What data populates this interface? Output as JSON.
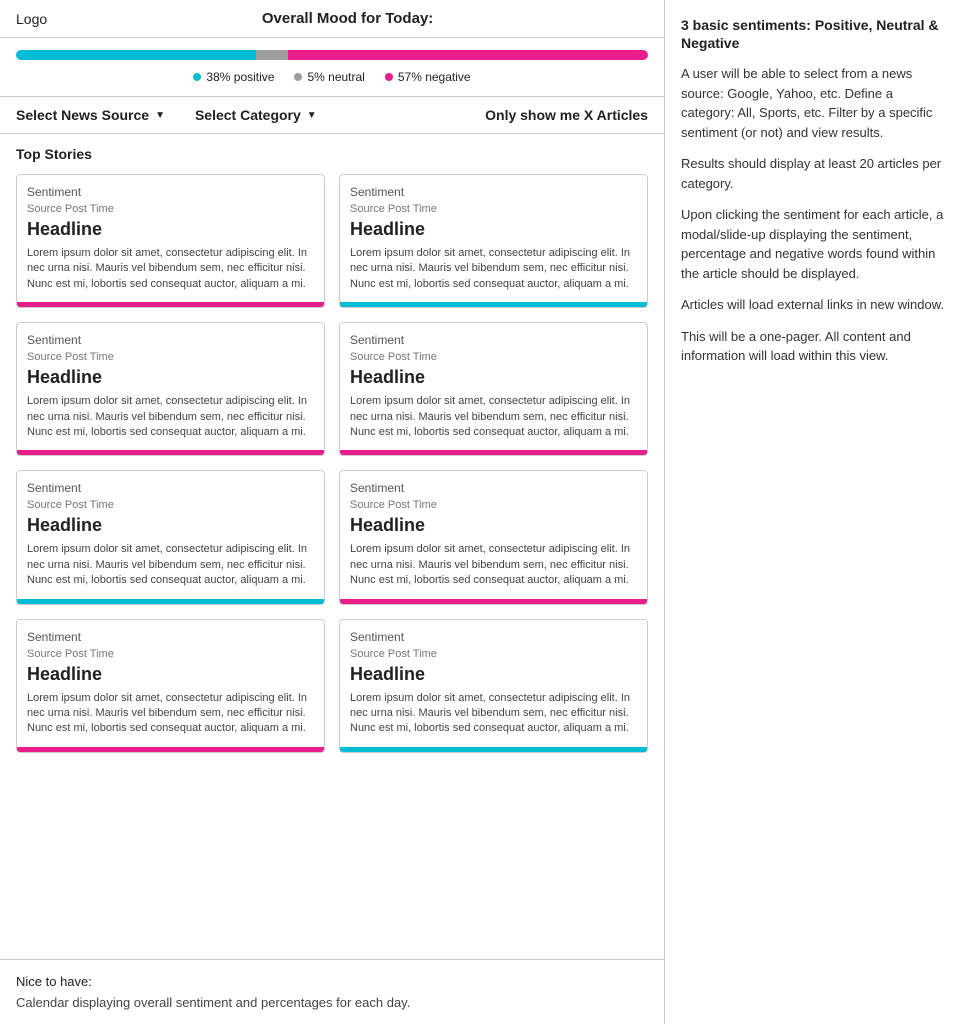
{
  "header": {
    "logo": "Logo",
    "overall_mood_label": "Overall Mood for Today:"
  },
  "mood": {
    "positive_pct": 38,
    "neutral_pct": 5,
    "negative_pct": 57,
    "positive_label": "38% positive",
    "neutral_label": "5% neutral",
    "negative_label": "57% negative"
  },
  "filters": {
    "news_source_label": "Select News Source",
    "category_label": "Select Category",
    "articles_label": "Only show me X Articles"
  },
  "stories": {
    "section_title": "Top Stories",
    "articles": [
      {
        "sentiment": "Sentiment",
        "meta": "Source  Post Time",
        "headline": "Headline",
        "body": "Lorem ipsum dolor sit amet, consectetur adipiscing elit. In nec urna nisi. Mauris vel bibendum sem, nec efficitur nisi. Nunc est mi, lobortis sed consequat auctor, aliquam a mi.",
        "border_color": "pink"
      },
      {
        "sentiment": "Sentiment",
        "meta": "Source  Post Time",
        "headline": "Headline",
        "body": "Lorem ipsum dolor sit amet, consectetur adipiscing elit. In nec urna nisi. Mauris vel bibendum sem, nec efficitur nisi. Nunc est mi, lobortis sed consequat auctor, aliquam a mi.",
        "border_color": "cyan"
      },
      {
        "sentiment": "Sentiment",
        "meta": "Source  Post Time",
        "headline": "Headline",
        "body": "Lorem ipsum dolor sit amet, consectetur adipiscing elit. In nec urna nisi. Mauris vel bibendum sem, nec efficitur nisi. Nunc est mi, lobortis sed consequat auctor, aliquam a mi.",
        "border_color": "pink"
      },
      {
        "sentiment": "Sentiment",
        "meta": "Source  Post Time",
        "headline": "Headline",
        "body": "Lorem ipsum dolor sit amet, consectetur adipiscing elit. In nec urna nisi. Mauris vel bibendum sem, nec efficitur nisi. Nunc est mi, lobortis sed consequat auctor, aliquam a mi.",
        "border_color": "pink"
      },
      {
        "sentiment": "Sentiment",
        "meta": "Source  Post Time",
        "headline": "Headline",
        "body": "Lorem ipsum dolor sit amet, consectetur adipiscing elit. In nec urna nisi. Mauris vel bibendum sem, nec efficitur nisi. Nunc est mi, lobortis sed consequat auctor, aliquam a mi.",
        "border_color": "cyan"
      },
      {
        "sentiment": "Sentiment",
        "meta": "Source  Post Time",
        "headline": "Headline",
        "body": "Lorem ipsum dolor sit amet, consectetur adipiscing elit. In nec urna nisi. Mauris vel bibendum sem, nec efficitur nisi. Nunc est mi, lobortis sed consequat auctor, aliquam a mi.",
        "border_color": "pink"
      },
      {
        "sentiment": "Sentiment",
        "meta": "Source  Post Time",
        "headline": "Headline",
        "body": "Lorem ipsum dolor sit amet, consectetur adipiscing elit. In nec urna nisi. Mauris vel bibendum sem, nec efficitur nisi. Nunc est mi, lobortis sed consequat auctor, aliquam a mi.",
        "border_color": "pink"
      },
      {
        "sentiment": "Sentiment",
        "meta": "Source  Post Time",
        "headline": "Headline",
        "body": "Lorem ipsum dolor sit amet, consectetur adipiscing elit. In nec urna nisi. Mauris vel bibendum sem, nec efficitur nisi. Nunc est mi, lobortis sed consequat auctor, aliquam a mi.",
        "border_color": "cyan"
      }
    ]
  },
  "footer": {
    "nice_to_have_label": "Nice to have:",
    "nice_to_have_text": "Calendar displaying overall sentiment and percentages for each day."
  },
  "sidebar": {
    "heading": "3 basic sentiments: Positive, Neutral & Negative",
    "paragraphs": [
      "A user will be able to select from a news source: Google, Yahoo, etc. Define a category: All, Sports, etc. Filter by a specific sentiment (or not) and view results.",
      "Results should display at least 20 articles per category.",
      "Upon clicking the sentiment for each article, a modal/slide-up displaying the sentiment, percentage and negative words found within the article should be displayed.",
      "Articles will load external links in new window.",
      "This will be a one-pager. All content and information will load within this view."
    ]
  }
}
